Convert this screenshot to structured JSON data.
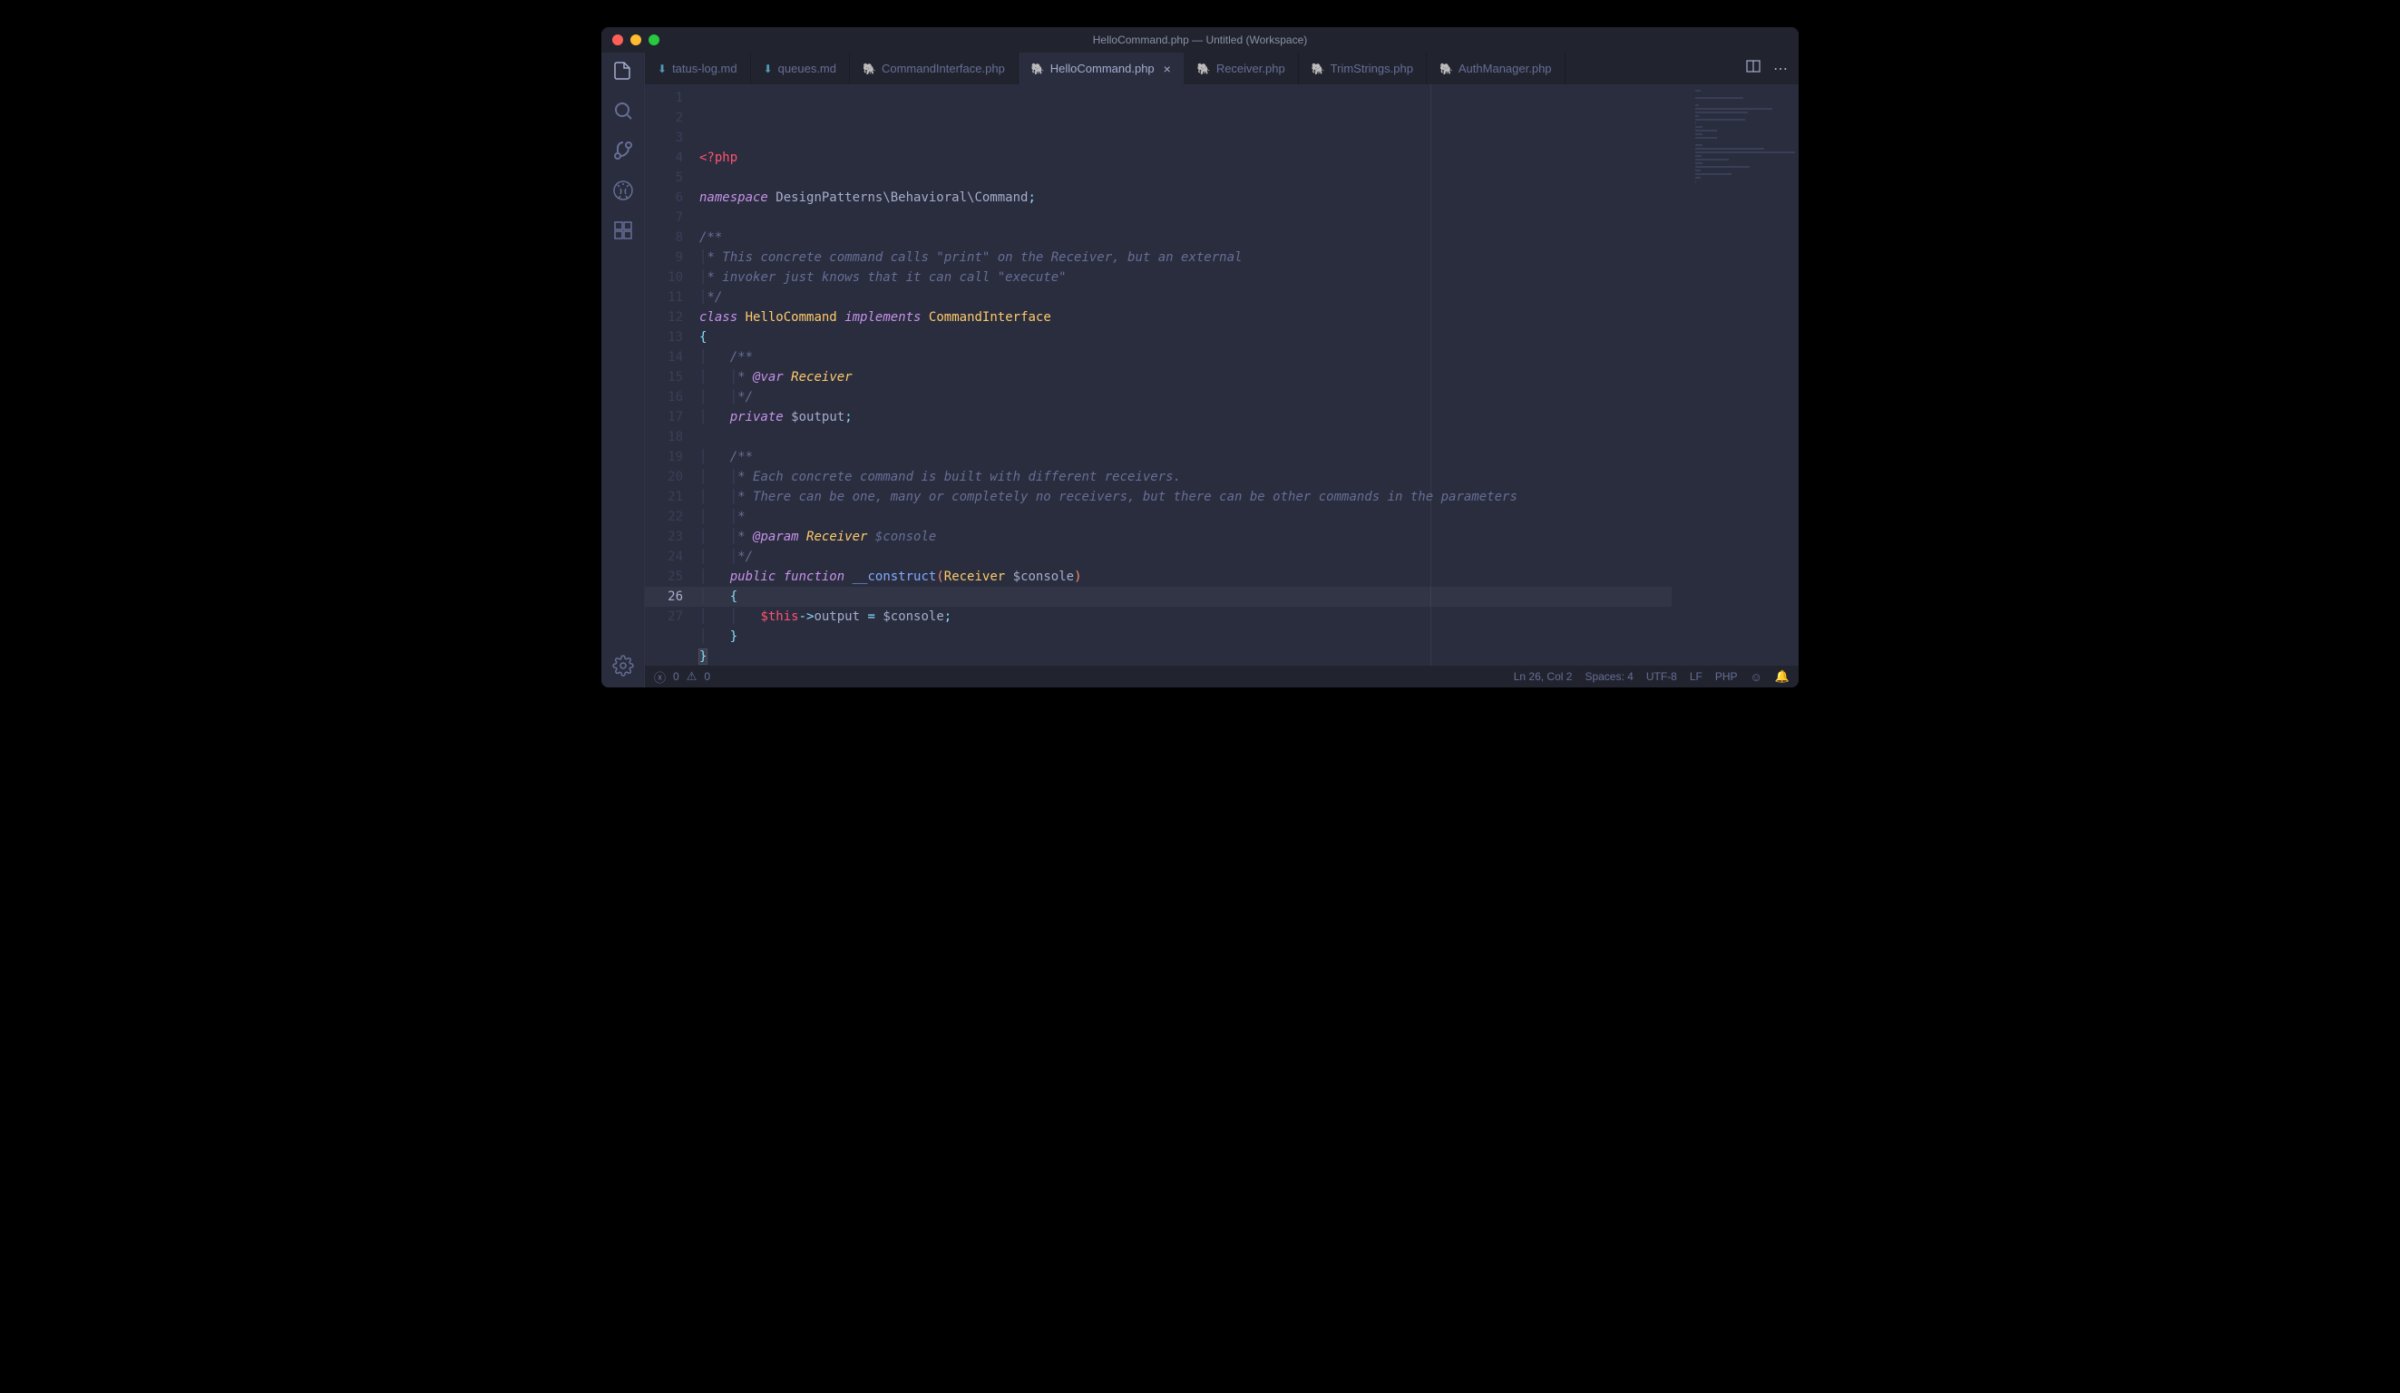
{
  "window": {
    "title": "HelloCommand.php — Untitled (Workspace)"
  },
  "tabs": [
    {
      "label": "tatus-log.md",
      "type": "md",
      "active": false
    },
    {
      "label": "queues.md",
      "type": "md",
      "active": false
    },
    {
      "label": "CommandInterface.php",
      "type": "php",
      "active": false
    },
    {
      "label": "HelloCommand.php",
      "type": "php",
      "active": true
    },
    {
      "label": "Receiver.php",
      "type": "php",
      "active": false
    },
    {
      "label": "TrimStrings.php",
      "type": "php",
      "active": false
    },
    {
      "label": "AuthManager.php",
      "type": "php",
      "active": false
    }
  ],
  "code": {
    "lines": [
      [
        {
          "c": "tok-tag",
          "t": "<?php"
        }
      ],
      [],
      [
        {
          "c": "tok-kw",
          "t": "namespace"
        },
        {
          "c": "",
          "t": " "
        },
        {
          "c": "tok-ns",
          "t": "DesignPatterns\\Behavioral\\Command"
        },
        {
          "c": "tok-punct",
          "t": ";"
        }
      ],
      [],
      [
        {
          "c": "tok-comment",
          "t": "/**"
        }
      ],
      [
        {
          "c": "tok-indent",
          "t": "│"
        },
        {
          "c": "tok-comment",
          "t": "* This concrete command calls \"print\" on the Receiver, but an external"
        }
      ],
      [
        {
          "c": "tok-indent",
          "t": "│"
        },
        {
          "c": "tok-comment",
          "t": "* invoker just knows that it can call \"execute\""
        }
      ],
      [
        {
          "c": "tok-indent",
          "t": "│"
        },
        {
          "c": "tok-comment",
          "t": "*/"
        }
      ],
      [
        {
          "c": "tok-kw",
          "t": "class"
        },
        {
          "c": "",
          "t": " "
        },
        {
          "c": "tok-class",
          "t": "HelloCommand"
        },
        {
          "c": "",
          "t": " "
        },
        {
          "c": "tok-kw",
          "t": "implements"
        },
        {
          "c": "",
          "t": " "
        },
        {
          "c": "tok-class",
          "t": "CommandInterface"
        }
      ],
      [
        {
          "c": "tok-punct",
          "t": "{"
        }
      ],
      [
        {
          "c": "tok-indent",
          "t": "│   "
        },
        {
          "c": "tok-comment",
          "t": "/**"
        }
      ],
      [
        {
          "c": "tok-indent",
          "t": "│   │"
        },
        {
          "c": "tok-comment",
          "t": "* "
        },
        {
          "c": "tok-doctag",
          "t": "@var"
        },
        {
          "c": "",
          "t": " "
        },
        {
          "c": "tok-type",
          "t": "Receiver"
        }
      ],
      [
        {
          "c": "tok-indent",
          "t": "│   │"
        },
        {
          "c": "tok-comment",
          "t": "*/"
        }
      ],
      [
        {
          "c": "tok-indent",
          "t": "│   "
        },
        {
          "c": "tok-kw",
          "t": "private"
        },
        {
          "c": "",
          "t": " "
        },
        {
          "c": "tok-var",
          "t": "$output"
        },
        {
          "c": "tok-punct",
          "t": ";"
        }
      ],
      [],
      [
        {
          "c": "tok-indent",
          "t": "│   "
        },
        {
          "c": "tok-comment",
          "t": "/**"
        }
      ],
      [
        {
          "c": "tok-indent",
          "t": "│   │"
        },
        {
          "c": "tok-comment",
          "t": "* Each concrete command is built with different receivers."
        }
      ],
      [
        {
          "c": "tok-indent",
          "t": "│   │"
        },
        {
          "c": "tok-comment",
          "t": "* There can be one, many or completely no receivers, but there can be other commands in the parameters"
        }
      ],
      [
        {
          "c": "tok-indent",
          "t": "│   │"
        },
        {
          "c": "tok-comment",
          "t": "*"
        }
      ],
      [
        {
          "c": "tok-indent",
          "t": "│   │"
        },
        {
          "c": "tok-comment",
          "t": "* "
        },
        {
          "c": "tok-doctag",
          "t": "@param"
        },
        {
          "c": "",
          "t": " "
        },
        {
          "c": "tok-type",
          "t": "Receiver"
        },
        {
          "c": "",
          "t": " "
        },
        {
          "c": "tok-comment",
          "t": "$console"
        }
      ],
      [
        {
          "c": "tok-indent",
          "t": "│   │"
        },
        {
          "c": "tok-comment",
          "t": "*/"
        }
      ],
      [
        {
          "c": "tok-indent",
          "t": "│   "
        },
        {
          "c": "tok-kw",
          "t": "public"
        },
        {
          "c": "",
          "t": " "
        },
        {
          "c": "tok-kw",
          "t": "function"
        },
        {
          "c": "",
          "t": " "
        },
        {
          "c": "tok-func",
          "t": "__construct"
        },
        {
          "c": "tok-paren",
          "t": "("
        },
        {
          "c": "tok-class",
          "t": "Receiver"
        },
        {
          "c": "",
          "t": " "
        },
        {
          "c": "tok-var",
          "t": "$console"
        },
        {
          "c": "tok-paren",
          "t": ")"
        }
      ],
      [
        {
          "c": "tok-indent",
          "t": "│   "
        },
        {
          "c": "tok-punct",
          "t": "{"
        }
      ],
      [
        {
          "c": "tok-indent",
          "t": "│   │   "
        },
        {
          "c": "tok-this",
          "t": "$this"
        },
        {
          "c": "tok-punct",
          "t": "->"
        },
        {
          "c": "tok-var",
          "t": "output"
        },
        {
          "c": "",
          "t": " "
        },
        {
          "c": "tok-punct",
          "t": "="
        },
        {
          "c": "",
          "t": " "
        },
        {
          "c": "tok-var",
          "t": "$console"
        },
        {
          "c": "tok-punct",
          "t": ";"
        }
      ],
      [
        {
          "c": "tok-indent",
          "t": "│   "
        },
        {
          "c": "tok-punct",
          "t": "}"
        }
      ],
      [
        {
          "c": "tok-punct cursor-hl",
          "t": "}"
        }
      ],
      []
    ],
    "currentLine": 26
  },
  "status": {
    "errors": "0",
    "warnings": "0",
    "position": "Ln 26, Col 2",
    "spaces": "Spaces: 4",
    "encoding": "UTF-8",
    "eol": "LF",
    "lang": "PHP"
  }
}
